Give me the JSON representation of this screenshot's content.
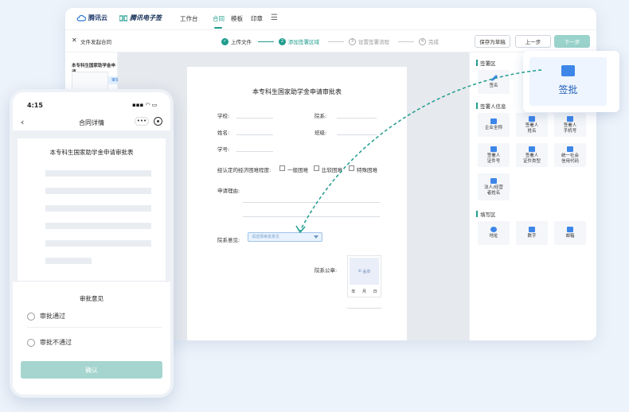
{
  "brand": {
    "tencent_cloud": "腾讯云",
    "esign": "腾讯电子签"
  },
  "topnav": {
    "items": [
      "工作台",
      "合同",
      "模板",
      "印章"
    ],
    "active": "合同"
  },
  "toolbar": {
    "close_title": "文件发起合同",
    "steps": [
      {
        "num": "1",
        "label": "上传文件",
        "state": "done"
      },
      {
        "num": "2",
        "label": "添加签署区域",
        "state": "current"
      },
      {
        "num": "3",
        "label": "设置签署流程",
        "state": "todo"
      },
      {
        "num": "4",
        "label": "完成",
        "state": "todo"
      }
    ],
    "save_draft": "保存为草稿",
    "prev": "上一步",
    "next": "下一步"
  },
  "left_panel": {
    "thumb_title": "本专科生国家助学金申请...",
    "tag": "审批意见"
  },
  "document": {
    "title": "本专科生国家助学金申请审批表",
    "school": "学校:",
    "faculty": "院系:",
    "name": "姓名:",
    "class": "班级:",
    "student_id": "学号:",
    "hardship": "经认定的经济困难程度:",
    "opt1": "一般困难",
    "opt2": "比较困难",
    "opt3": "特殊困难",
    "reason": "申请理由:",
    "opinion": "院系意见:",
    "opinion_placeholder": "请选择审批意见",
    "seal": "院系公章:",
    "seal_btn": "盖章",
    "year": "年",
    "month": "月",
    "day": "日"
  },
  "right_panel": {
    "sign_area": "签署区",
    "sign_cards": [
      "签名"
    ],
    "signer_info": "签署人信息",
    "info_cards": [
      "企业全称",
      "签署人\n姓名",
      "签署人\n手机号",
      "签署人\n证件号",
      "签署人\n证件类型",
      "统一社会\n信用代码",
      "法人/经营\n者姓名"
    ],
    "fill_area": "填写区",
    "fill_cards": [
      "地址",
      "数字",
      "邮箱"
    ]
  },
  "popup": {
    "label": "签批"
  },
  "phone": {
    "time": "4:15",
    "status": "▪▪▪ ◠ ▭",
    "title": "合同详情",
    "more": "•••",
    "doc_title": "本专科生国家助学金申请审批表",
    "sheet_title": "审批意见",
    "approve": "审批通过",
    "reject": "审批不通过",
    "confirm": "确认"
  },
  "colors": {
    "accent": "#1f9c8e",
    "blue": "#2e7bd3"
  }
}
